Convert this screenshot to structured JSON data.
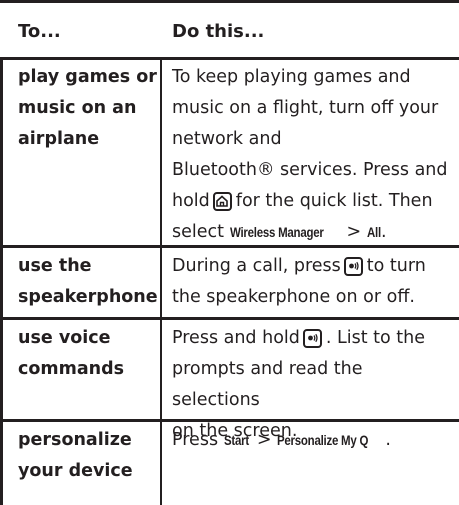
{
  "header": {
    "col1": "To...",
    "col2": "Do this..."
  },
  "rows": [
    {
      "task_lines": [
        "play games or",
        "music on an",
        "airplane"
      ],
      "text": {
        "l1": "To keep playing games and",
        "l2": "music on a flight, turn off your",
        "l3": "network and",
        "l4": "Bluetooth® services. Press and",
        "l5a": "hold",
        "l5b": "for the quick list. Then",
        "l6a": "select",
        "l6m1": "Wireless Manager",
        "l6gt": ">",
        "l6m2": "All",
        "l6end": "."
      },
      "icon": "home-key-icon"
    },
    {
      "task_lines": [
        "use the",
        "speakerphone"
      ],
      "text": {
        "l1a": "During a call, press",
        "l1b": "to turn",
        "l2": "the speakerphone on or off."
      },
      "icon": "speakerphone-key-icon"
    },
    {
      "task_lines": [
        "use voice",
        "commands"
      ],
      "text": {
        "l1a": "Press and hold",
        "l1b": ". List to the",
        "l2": "prompts and read the selections",
        "l3": "on the screen."
      },
      "icon": "speakerphone-key-icon"
    },
    {
      "task_lines": [
        "personalize",
        "your device"
      ],
      "text": {
        "l1a": "Press",
        "l1m1": "Start",
        "l1gt": ">",
        "l1m2": "Personalize My Q",
        "l1end": "."
      }
    }
  ]
}
